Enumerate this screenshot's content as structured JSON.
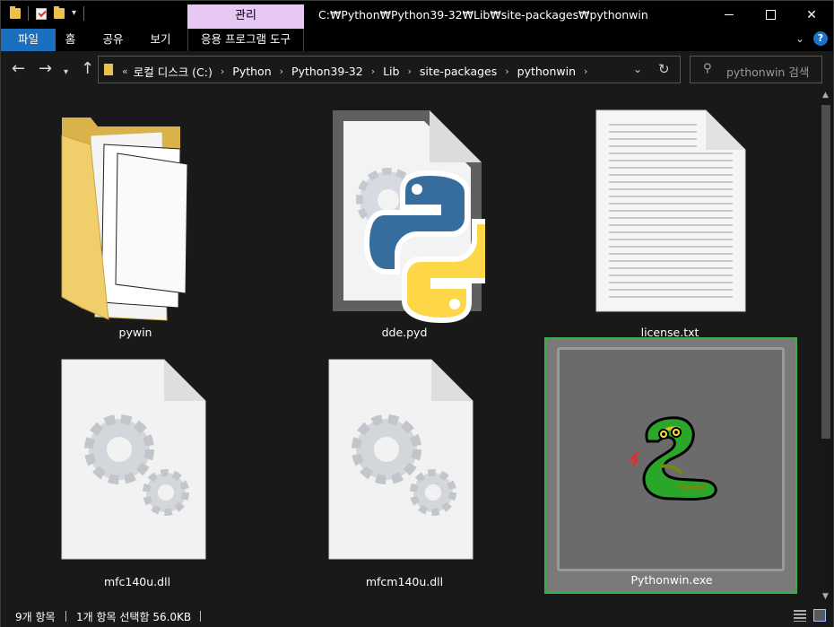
{
  "titlebar": {
    "manage_tab": "관리",
    "path": "C:₩Python₩Python39-32₩Lib₩site-packages₩pythonwin"
  },
  "ribbon": {
    "tabs": [
      "파일",
      "홈",
      "공유",
      "보기"
    ],
    "app_tools": "응용 프로그램 도구"
  },
  "address": {
    "overflow": "«",
    "crumbs": [
      "로컬 디스크 (C:)",
      "Python",
      "Python39-32",
      "Lib",
      "site-packages",
      "pythonwin"
    ]
  },
  "search": {
    "placeholder": "pythonwin 검색"
  },
  "files": [
    {
      "name": "pywin",
      "type": "folder"
    },
    {
      "name": "dde.pyd",
      "type": "python-extension"
    },
    {
      "name": "license.txt",
      "type": "text"
    },
    {
      "name": "mfc140u.dll",
      "type": "dll"
    },
    {
      "name": "mfcm140u.dll",
      "type": "dll"
    },
    {
      "name": "Pythonwin.exe",
      "type": "executable",
      "selected": true
    }
  ],
  "status": {
    "count": "9개 항목",
    "selection": "1개 항목 선택함 56.0KB"
  },
  "colors": {
    "accent": "#1b6fbf",
    "manage_tab": "#e7c8f5",
    "selection_border": "#36b24a",
    "folder": "#e9c14b"
  }
}
